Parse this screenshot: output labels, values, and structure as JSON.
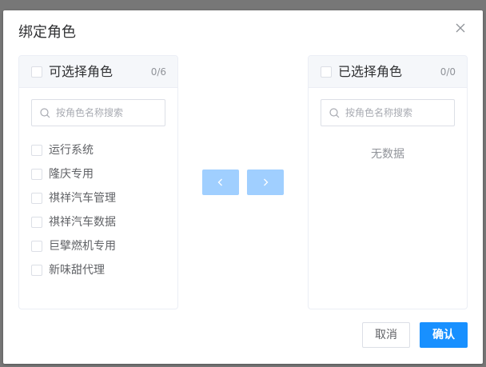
{
  "dialog": {
    "title": "绑定角色",
    "close_icon": "close-icon"
  },
  "source": {
    "title": "可选择角色",
    "count": "0/6",
    "filter_placeholder": "按角色名称搜索",
    "items": [
      {
        "label": "运行系统"
      },
      {
        "label": "隆庆专用"
      },
      {
        "label": "祺祥汽车管理"
      },
      {
        "label": "祺祥汽车数据"
      },
      {
        "label": "巨擘燃机专用"
      },
      {
        "label": "新味甜代理"
      }
    ]
  },
  "target": {
    "title": "已选择角色",
    "count": "0/0",
    "filter_placeholder": "按角色名称搜索",
    "empty_text": "无数据"
  },
  "transfer_buttons": {
    "prev_icon": "chevron-left-icon",
    "next_icon": "chevron-right-icon"
  },
  "footer": {
    "cancel_label": "取消",
    "confirm_label": "确认"
  },
  "colors": {
    "primary": "#1890ff",
    "transfer_disabled": "#a0cfff",
    "border": "#dcdfe6",
    "header_bg": "#f5f7fa",
    "overlay": "#777777"
  }
}
